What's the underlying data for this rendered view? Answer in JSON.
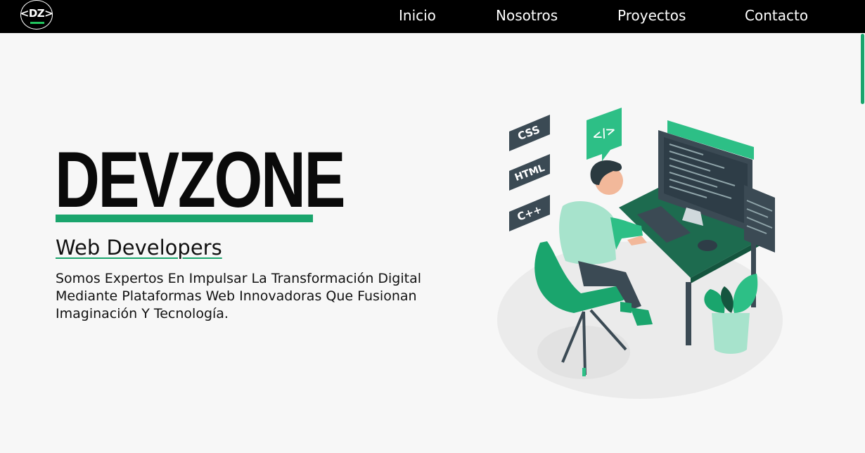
{
  "brand": {
    "logo_text": "<DZ>"
  },
  "nav": {
    "items": [
      "Inicio",
      "Nosotros",
      "Proyectos",
      "Contacto"
    ]
  },
  "hero": {
    "title": "DEVZONE",
    "subtitle": "Web Developers",
    "description": "Somos Expertos En Impulsar La Transformación Digital Mediante Plataformas Web Innovadoras Que Fusionan Imaginación Y Tecnología."
  },
  "illustration": {
    "tags": [
      "CSS",
      "HTML",
      "C++"
    ],
    "code_bubble": "</>"
  },
  "colors": {
    "accent": "#1aa56d",
    "navbar": "#000000",
    "background": "#f7f7f7"
  }
}
